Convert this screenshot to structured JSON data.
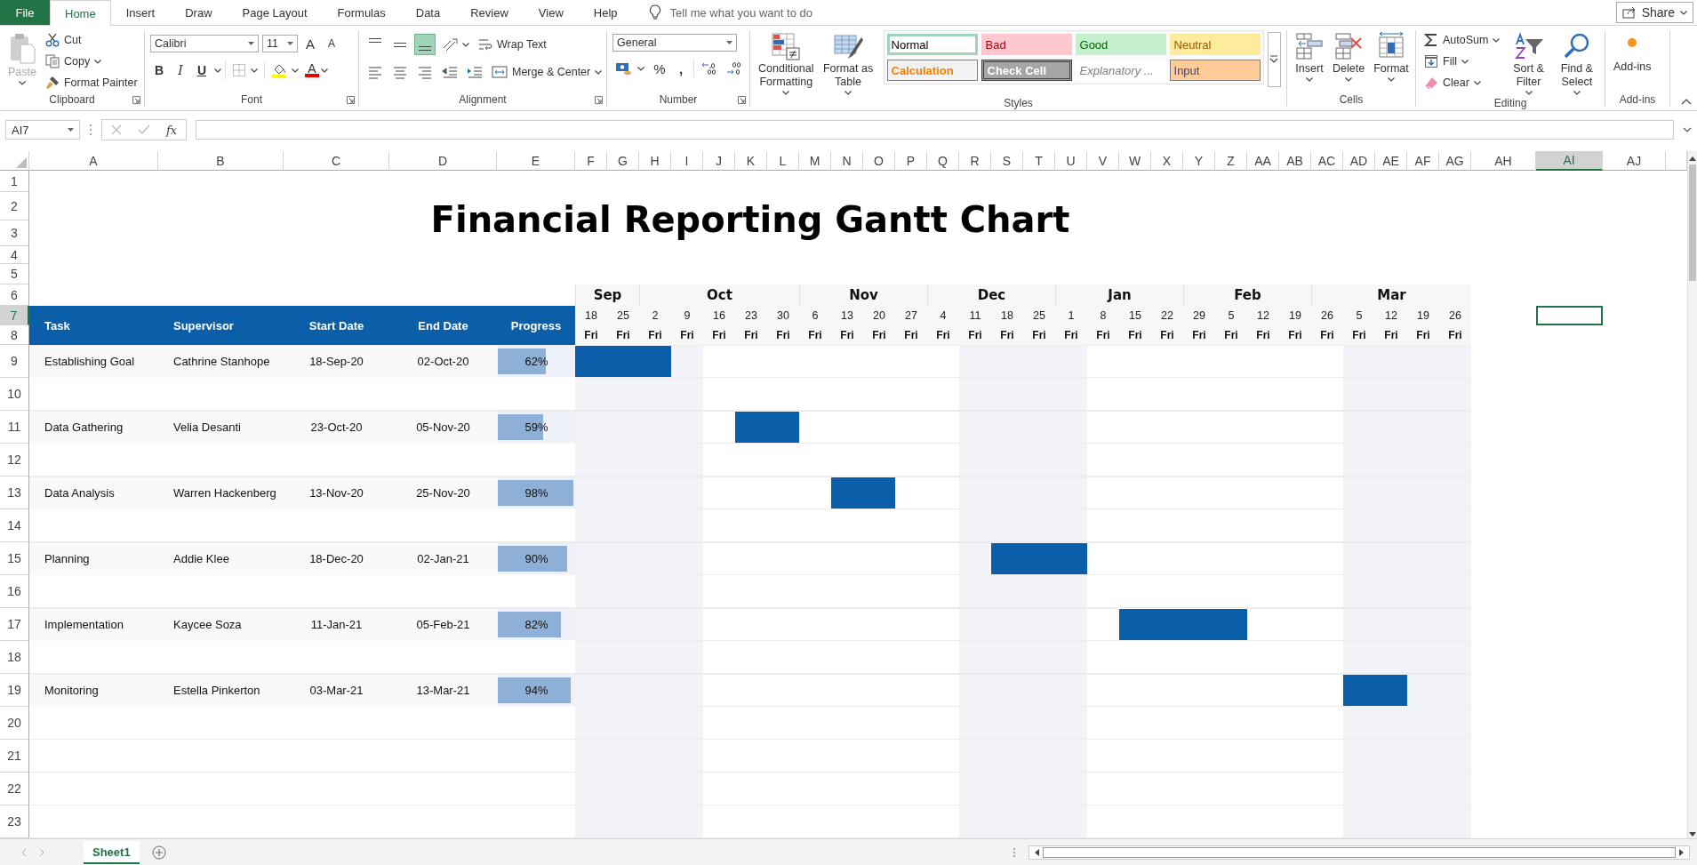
{
  "ribbon_tabs": [
    {
      "label": "File",
      "kind": "file",
      "selected": false
    },
    {
      "label": "Home",
      "kind": "tab",
      "selected": true
    },
    {
      "label": "Insert",
      "kind": "tab",
      "selected": false
    },
    {
      "label": "Draw",
      "kind": "tab",
      "selected": false
    },
    {
      "label": "Page Layout",
      "kind": "tab",
      "selected": false
    },
    {
      "label": "Formulas",
      "kind": "tab",
      "selected": false
    },
    {
      "label": "Data",
      "kind": "tab",
      "selected": false
    },
    {
      "label": "Review",
      "kind": "tab",
      "selected": false
    },
    {
      "label": "View",
      "kind": "tab",
      "selected": false
    },
    {
      "label": "Help",
      "kind": "tab",
      "selected": false
    }
  ],
  "tell_me": {
    "placeholder": "Tell me what you want to do"
  },
  "share_button": {
    "label": "Share"
  },
  "ribbon": {
    "clipboard": {
      "title": "Clipboard",
      "paste": {
        "label": "Paste",
        "disabled": true
      },
      "cut": "Cut",
      "copy": "Copy",
      "format_painter": "Format Painter"
    },
    "font": {
      "title": "Font",
      "font_name": "Calibri",
      "font_size": "11",
      "grow": "A",
      "shrink": "A",
      "bold": "B",
      "italic": "I",
      "underline": "U",
      "font_color": "A"
    },
    "alignment": {
      "title": "Alignment",
      "vertical": [
        {
          "selected": false
        },
        {
          "selected": false
        },
        {
          "selected": true
        }
      ],
      "wrap_text": "Wrap Text",
      "merge_center": "Merge & Center"
    },
    "number": {
      "title": "Number",
      "format": "General",
      "percent": "%",
      "comma": ","
    },
    "styles": {
      "title": "Styles",
      "conditional_formatting": "Conditional Formatting",
      "format_as_table": "Format as Table",
      "gallery": [
        {
          "label": "Normal",
          "kind": "normal",
          "selected": true
        },
        {
          "label": "Bad",
          "kind": "bad",
          "selected": false
        },
        {
          "label": "Good",
          "kind": "good",
          "selected": false
        },
        {
          "label": "Neutral",
          "kind": "neutral",
          "selected": false
        },
        {
          "label": "Calculation",
          "kind": "calculation",
          "selected": false
        },
        {
          "label": "Check Cell",
          "kind": "check",
          "selected": false
        },
        {
          "label": "Explanatory ...",
          "kind": "explanatory",
          "selected": false
        },
        {
          "label": "Input",
          "kind": "input",
          "selected": false
        }
      ]
    },
    "cells": {
      "title": "Cells",
      "insert": "Insert",
      "delete": "Delete",
      "format": "Format"
    },
    "editing": {
      "title": "Editing",
      "autosum": "AutoSum",
      "fill": "Fill",
      "clear": "Clear",
      "sort_filter": "Sort & Filter",
      "find_select": "Find & Select"
    },
    "addins": {
      "title": "Add-ins",
      "button": "Add-ins"
    }
  },
  "formula_bar": {
    "name_box": "AI7",
    "fx": "fx"
  },
  "sheet": {
    "columns": [
      {
        "label": "A",
        "selected": false
      },
      {
        "label": "B",
        "selected": false
      },
      {
        "label": "C",
        "selected": false
      },
      {
        "label": "D",
        "selected": false
      },
      {
        "label": "E",
        "selected": false
      },
      {
        "label": "F",
        "selected": false
      },
      {
        "label": "G",
        "selected": false
      },
      {
        "label": "H",
        "selected": false
      },
      {
        "label": "I",
        "selected": false
      },
      {
        "label": "J",
        "selected": false
      },
      {
        "label": "K",
        "selected": false
      },
      {
        "label": "L",
        "selected": false
      },
      {
        "label": "M",
        "selected": false
      },
      {
        "label": "N",
        "selected": false
      },
      {
        "label": "O",
        "selected": false
      },
      {
        "label": "P",
        "selected": false
      },
      {
        "label": "Q",
        "selected": false
      },
      {
        "label": "R",
        "selected": false
      },
      {
        "label": "S",
        "selected": false
      },
      {
        "label": "T",
        "selected": false
      },
      {
        "label": "U",
        "selected": false
      },
      {
        "label": "V",
        "selected": false
      },
      {
        "label": "W",
        "selected": false
      },
      {
        "label": "X",
        "selected": false
      },
      {
        "label": "Y",
        "selected": false
      },
      {
        "label": "Z",
        "selected": false
      },
      {
        "label": "AA",
        "selected": false
      },
      {
        "label": "AB",
        "selected": false
      },
      {
        "label": "AC",
        "selected": false
      },
      {
        "label": "AD",
        "selected": false
      },
      {
        "label": "AE",
        "selected": false
      },
      {
        "label": "AF",
        "selected": false
      },
      {
        "label": "AG",
        "selected": false
      },
      {
        "label": "AH",
        "selected": false
      },
      {
        "label": "AI",
        "selected": true
      },
      {
        "label": "AJ",
        "selected": false
      }
    ],
    "rows": [
      {
        "label": "1",
        "selected": false
      },
      {
        "label": "2",
        "selected": false
      },
      {
        "label": "3",
        "selected": false
      },
      {
        "label": "4",
        "selected": false
      },
      {
        "label": "5",
        "selected": false
      },
      {
        "label": "6",
        "selected": false
      },
      {
        "label": "7",
        "selected": true
      },
      {
        "label": "8",
        "selected": false
      },
      {
        "label": "9",
        "selected": false
      },
      {
        "label": "10",
        "selected": false
      },
      {
        "label": "11",
        "selected": false
      },
      {
        "label": "12",
        "selected": false
      },
      {
        "label": "13",
        "selected": false
      },
      {
        "label": "14",
        "selected": false
      },
      {
        "label": "15",
        "selected": false
      },
      {
        "label": "16",
        "selected": false
      },
      {
        "label": "17",
        "selected": false
      },
      {
        "label": "18",
        "selected": false
      },
      {
        "label": "19",
        "selected": false
      },
      {
        "label": "20",
        "selected": false
      },
      {
        "label": "21",
        "selected": false
      },
      {
        "label": "22",
        "selected": false
      },
      {
        "label": "23",
        "selected": false
      }
    ],
    "title": "Financial Reporting Gantt Chart",
    "table_headers": [
      "Task",
      "Supervisor",
      "Start Date",
      "End Date",
      "Progress"
    ],
    "months": [
      {
        "label": "Sep",
        "weeks": [
          {
            "day": "18",
            "weekday": "Fri",
            "shaded": true
          },
          {
            "day": "25",
            "weekday": "Fri",
            "shaded": true
          }
        ]
      },
      {
        "label": "Oct",
        "weeks": [
          {
            "day": "2",
            "weekday": "Fri",
            "shaded": true
          },
          {
            "day": "9",
            "weekday": "Fri",
            "shaded": true
          },
          {
            "day": "16",
            "weekday": "Fri",
            "shaded": false
          },
          {
            "day": "23",
            "weekday": "Fri",
            "shaded": false
          },
          {
            "day": "30",
            "weekday": "Fri",
            "shaded": false
          }
        ]
      },
      {
        "label": "Nov",
        "weeks": [
          {
            "day": "6",
            "weekday": "Fri",
            "shaded": false
          },
          {
            "day": "13",
            "weekday": "Fri",
            "shaded": false
          },
          {
            "day": "20",
            "weekday": "Fri",
            "shaded": false
          },
          {
            "day": "27",
            "weekday": "Fri",
            "shaded": false
          }
        ]
      },
      {
        "label": "Dec",
        "weeks": [
          {
            "day": "4",
            "weekday": "Fri",
            "shaded": false
          },
          {
            "day": "11",
            "weekday": "Fri",
            "shaded": true
          },
          {
            "day": "18",
            "weekday": "Fri",
            "shaded": true
          },
          {
            "day": "25",
            "weekday": "Fri",
            "shaded": true
          }
        ]
      },
      {
        "label": "Jan",
        "weeks": [
          {
            "day": "1",
            "weekday": "Fri",
            "shaded": true
          },
          {
            "day": "8",
            "weekday": "Fri",
            "shaded": false
          },
          {
            "day": "15",
            "weekday": "Fri",
            "shaded": false
          },
          {
            "day": "22",
            "weekday": "Fri",
            "shaded": false
          }
        ]
      },
      {
        "label": "Feb",
        "weeks": [
          {
            "day": "29",
            "weekday": "Fri",
            "shaded": false
          },
          {
            "day": "5",
            "weekday": "Fri",
            "shaded": false
          },
          {
            "day": "12",
            "weekday": "Fri",
            "shaded": false
          },
          {
            "day": "19",
            "weekday": "Fri",
            "shaded": false
          }
        ]
      },
      {
        "label": "Mar",
        "weeks": [
          {
            "day": "26",
            "weekday": "Fri",
            "shaded": false
          },
          {
            "day": "5",
            "weekday": "Fri",
            "shaded": true
          },
          {
            "day": "12",
            "weekday": "Fri",
            "shaded": true
          },
          {
            "day": "19",
            "weekday": "Fri",
            "shaded": true
          },
          {
            "day": "26",
            "weekday": "Fri",
            "shaded": true
          }
        ]
      }
    ],
    "tasks": [
      {
        "task": "Establishing Goal",
        "supervisor": "Cathrine Stanhope",
        "start": "18-Sep-20",
        "end": "02-Oct-20",
        "progress": "62%",
        "level": 0.62,
        "schedule": [
          true,
          true,
          true,
          false,
          false,
          false,
          false,
          false,
          false,
          false,
          false,
          false,
          false,
          false,
          false,
          false,
          false,
          false,
          false,
          false,
          false,
          false,
          false,
          false,
          false,
          false,
          false,
          false
        ]
      },
      {
        "task": "Data Gathering",
        "supervisor": "Velia Desanti",
        "start": "23-Oct-20",
        "end": "05-Nov-20",
        "progress": "59%",
        "level": 0.59,
        "schedule": [
          false,
          false,
          false,
          false,
          false,
          true,
          true,
          false,
          false,
          false,
          false,
          false,
          false,
          false,
          false,
          false,
          false,
          false,
          false,
          false,
          false,
          false,
          false,
          false,
          false,
          false,
          false,
          false
        ]
      },
      {
        "task": "Data Analysis",
        "supervisor": "Warren Hackenberg",
        "start": "13-Nov-20",
        "end": "25-Nov-20",
        "progress": "98%",
        "level": 0.98,
        "schedule": [
          false,
          false,
          false,
          false,
          false,
          false,
          false,
          false,
          true,
          true,
          false,
          false,
          false,
          false,
          false,
          false,
          false,
          false,
          false,
          false,
          false,
          false,
          false,
          false,
          false,
          false,
          false,
          false
        ]
      },
      {
        "task": "Planning",
        "supervisor": "Addie Klee",
        "start": "18-Dec-20",
        "end": "02-Jan-21",
        "progress": "90%",
        "level": 0.9,
        "schedule": [
          false,
          false,
          false,
          false,
          false,
          false,
          false,
          false,
          false,
          false,
          false,
          false,
          false,
          true,
          true,
          true,
          false,
          false,
          false,
          false,
          false,
          false,
          false,
          false,
          false,
          false,
          false,
          false
        ]
      },
      {
        "task": "Implementation",
        "supervisor": "Kaycee Soza",
        "start": "11-Jan-21",
        "end": "05-Feb-21",
        "progress": "82%",
        "level": 0.82,
        "schedule": [
          false,
          false,
          false,
          false,
          false,
          false,
          false,
          false,
          false,
          false,
          false,
          false,
          false,
          false,
          false,
          false,
          false,
          true,
          true,
          true,
          true,
          false,
          false,
          false,
          false,
          false,
          false,
          false
        ]
      },
      {
        "task": "Monitoring",
        "supervisor": "Estella Pinkerton",
        "start": "03-Mar-21",
        "end": "13-Mar-21",
        "progress": "94%",
        "level": 0.94,
        "schedule": [
          false,
          false,
          false,
          false,
          false,
          false,
          false,
          false,
          false,
          false,
          false,
          false,
          false,
          false,
          false,
          false,
          false,
          false,
          false,
          false,
          false,
          false,
          false,
          false,
          true,
          true,
          false,
          false
        ]
      }
    ]
  },
  "sheet_tabs": [
    {
      "label": "Sheet1",
      "selected": true
    }
  ]
}
